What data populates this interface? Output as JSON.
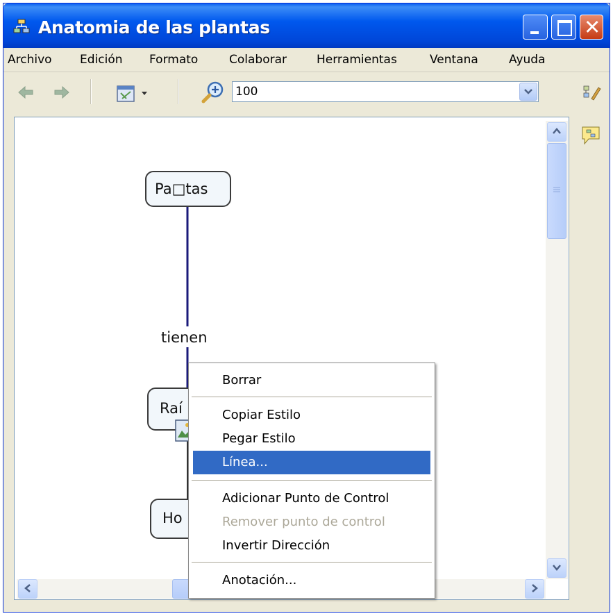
{
  "window": {
    "title": "Anatomia de las plantas"
  },
  "menubar": {
    "items": [
      "Archivo",
      "Edición",
      "Formato",
      "Colaborar",
      "Herramientas",
      "Ventana",
      "Ayuda"
    ]
  },
  "toolbar": {
    "zoom_value": "100"
  },
  "icons": {
    "app": "concept-map-icon",
    "back": "back-arrow-icon",
    "forward": "forward-arrow-icon",
    "view_menu": "view-layout-icon",
    "zoom": "zoom-in-icon",
    "styles": "styles-palette-icon",
    "annotation": "annotation-icon"
  },
  "concept_map": {
    "concepts": [
      "Pa□tas",
      "Raí",
      "Ho"
    ],
    "link_label": "tienen"
  },
  "context_menu": {
    "items": [
      {
        "label": "Borrar",
        "enabled": true
      },
      {
        "label": "Copiar Estilo",
        "enabled": true
      },
      {
        "label": "Pegar Estilo",
        "enabled": true
      },
      {
        "label": "Línea...",
        "enabled": true,
        "highlighted": true
      },
      {
        "label": "Adicionar Punto de Control",
        "enabled": true
      },
      {
        "label": "Remover punto de control",
        "enabled": false
      },
      {
        "label": "Invertir Dirección",
        "enabled": true
      },
      {
        "label": "Anotación...",
        "enabled": true
      }
    ]
  },
  "colors": {
    "titlebar": "#0058ee",
    "highlight": "#316ac5",
    "connector": "#1a1a7a",
    "disabled_text": "#aca899"
  }
}
